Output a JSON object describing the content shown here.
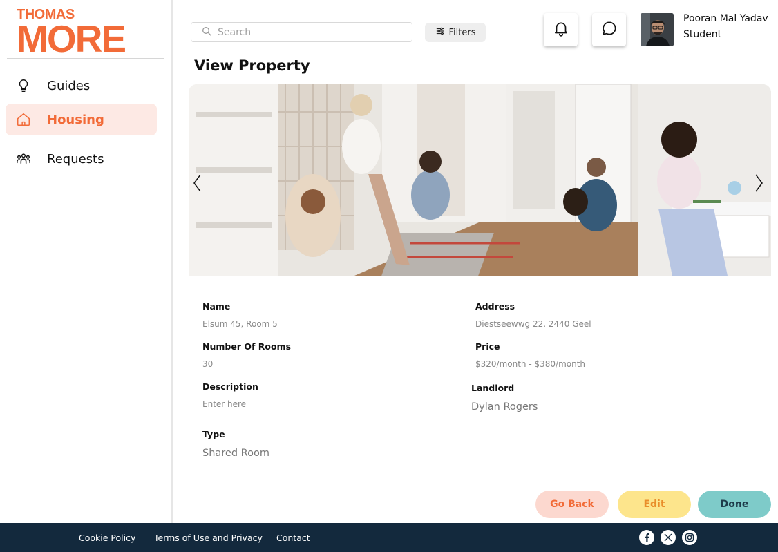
{
  "brand": {
    "line1": "THOMAS",
    "line2": "MORE",
    "color": "#f26b38"
  },
  "sidebar": {
    "items": [
      {
        "label": "Guides",
        "icon": "lightbulb-icon",
        "active": false
      },
      {
        "label": "Housing",
        "icon": "home-icon",
        "active": true
      },
      {
        "label": "Requests",
        "icon": "users-icon",
        "active": false
      }
    ]
  },
  "header": {
    "search": {
      "placeholder": "Search",
      "value": ""
    },
    "filters_label": "Filters",
    "user": {
      "name": "Pooran Mal Yadav",
      "role": "Student"
    }
  },
  "page": {
    "title": "View Property"
  },
  "property": {
    "name_label": "Name",
    "name_value": "Elsum 45, Room 5",
    "address_label": "Address",
    "address_value": "Diestseewwg 22. 2440 Geel",
    "rooms_label": "Number Of Rooms",
    "rooms_value": "30",
    "price_label": "Price",
    "price_value": "$320/month - $380/month",
    "description_label": "Description",
    "description_value": "Enter here",
    "landlord_label": "Landlord",
    "landlord_value": "Dylan Rogers",
    "type_label": "Type",
    "type_value": "Shared Room"
  },
  "actions": {
    "back": "Go Back",
    "edit": "Edit",
    "done": "Done"
  },
  "footer": {
    "links": [
      "Cookie Policy",
      "Terms of Use and Privacy",
      "Contact"
    ],
    "social": [
      "facebook-icon",
      "x-icon",
      "instagram-icon"
    ]
  },
  "colors": {
    "accent": "#f26b38",
    "footer": "#13293d",
    "done": "#7ecbc9",
    "edit": "#fde58c",
    "back": "#fcd8cf"
  }
}
